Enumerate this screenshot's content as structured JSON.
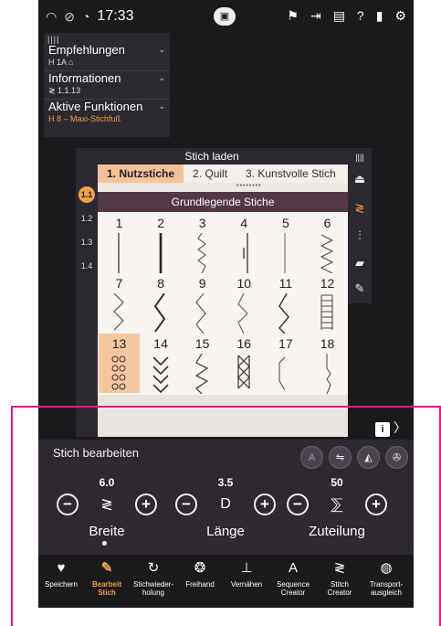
{
  "status": {
    "time": "17:33"
  },
  "info_panel": {
    "empfehlungen": {
      "label": "Empfehlungen",
      "value": "1A"
    },
    "informationen": {
      "label": "Informationen",
      "value": "1.1.13"
    },
    "aktive": {
      "label": "Aktive Funktionen",
      "value": "8 – Maxi-Stichfuß"
    }
  },
  "stitch_panel": {
    "title": "Stich laden",
    "tabs": [
      "1. Nutzstiche",
      "2. Quilt",
      "3. Kunstvolle Stich"
    ],
    "category_title": "Grundlegende Stiche",
    "categories": [
      "1.1",
      "1.2",
      "1.3",
      "1.4"
    ],
    "stitches": [
      "1",
      "2",
      "3",
      "4",
      "5",
      "6",
      "7",
      "8",
      "9",
      "10",
      "11",
      "12",
      "13",
      "14",
      "15",
      "16",
      "17",
      "18"
    ],
    "selected_stitch": "13"
  },
  "edit": {
    "title": "Stich bearbeiten",
    "params": [
      {
        "label": "Breite",
        "value": "6.0"
      },
      {
        "label": "Länge",
        "value": "3.5"
      },
      {
        "label": "Zuteilung",
        "value": "50"
      }
    ]
  },
  "bottom_nav": [
    {
      "label": "Speichern",
      "icon": "heart-icon"
    },
    {
      "label": "Bearbeit Stich",
      "icon": "edit-stitch-icon"
    },
    {
      "label": "Stichwieder-holung",
      "icon": "repeat-icon"
    },
    {
      "label": "Freihand",
      "icon": "freehand-icon"
    },
    {
      "label": "Vernähen",
      "icon": "tie-off-icon"
    },
    {
      "label": "Sequence Creator",
      "icon": "sequence-creator-icon"
    },
    {
      "label": "Stitch Creator",
      "icon": "stitch-creator-icon"
    },
    {
      "label": "Transport-ausgleich",
      "icon": "balance-icon"
    }
  ],
  "colors": {
    "accent": "#f0a14a",
    "highlight_frame": "#e8187f",
    "selected_cell": "#f6c79f"
  }
}
